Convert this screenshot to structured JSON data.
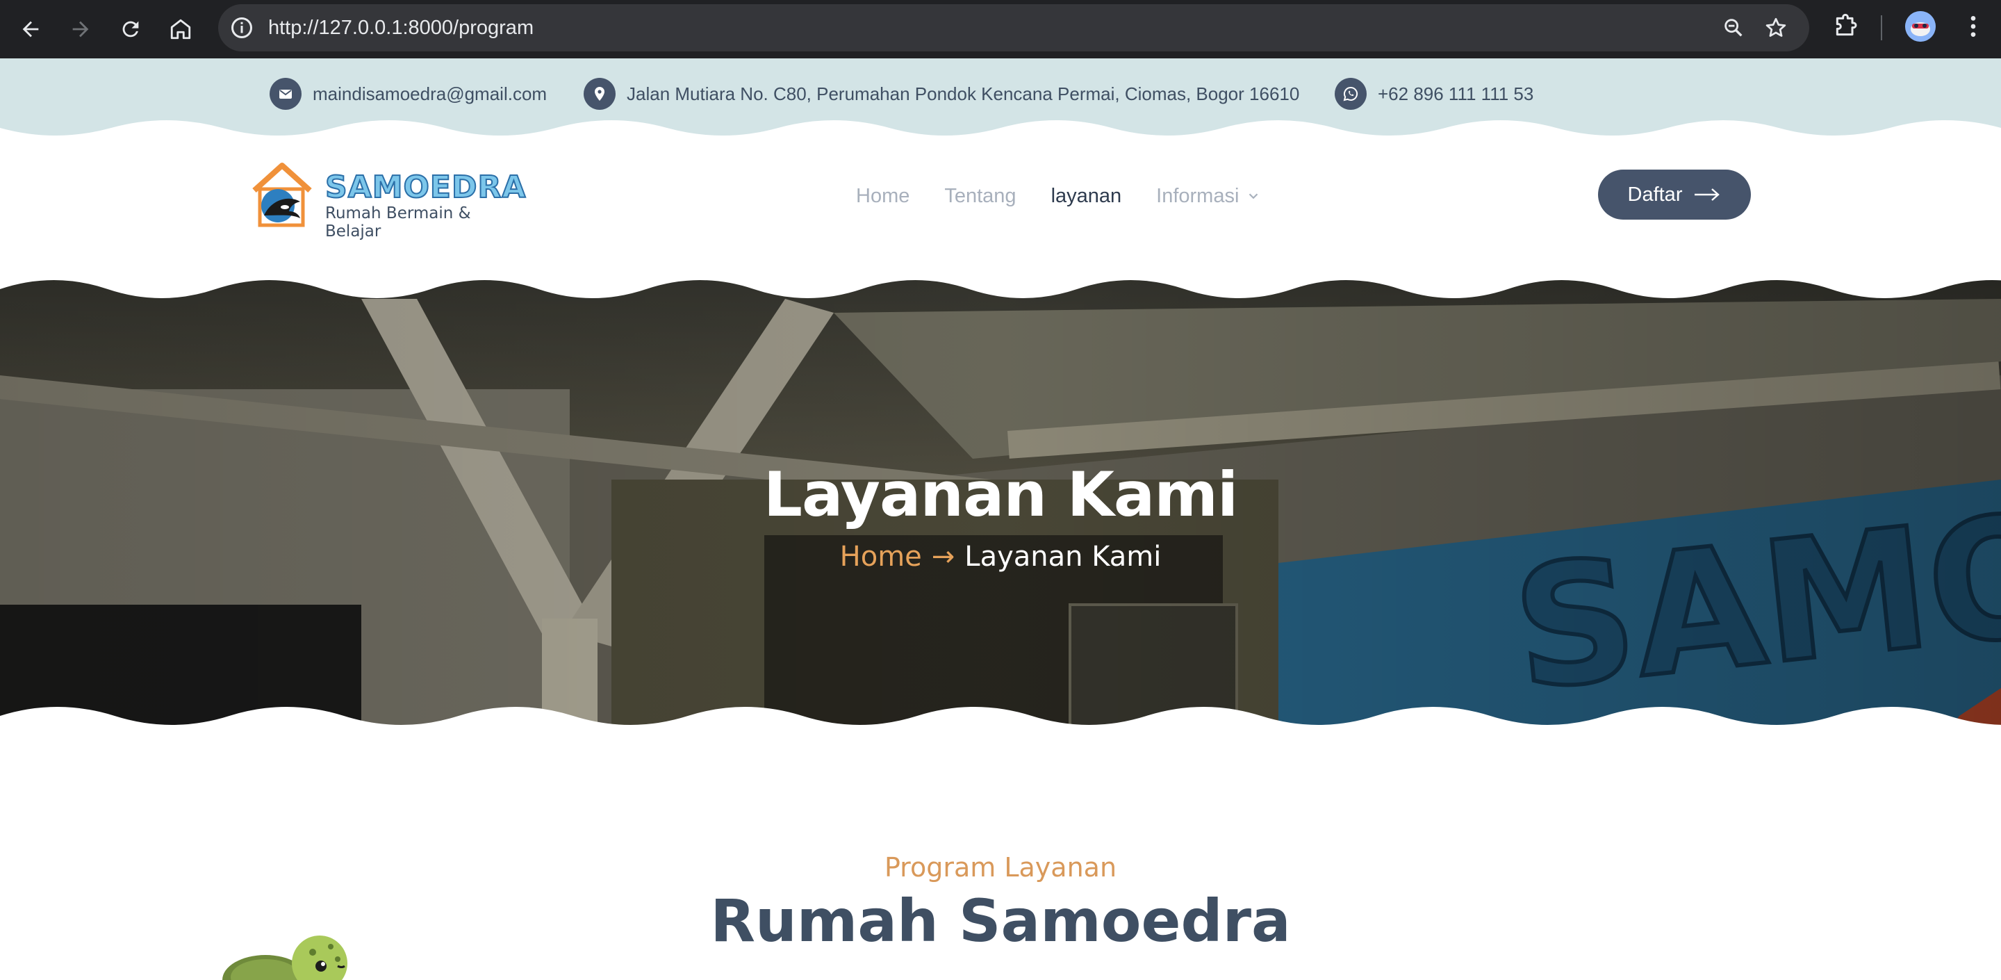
{
  "browser": {
    "url": "http://127.0.0.1:8000/program"
  },
  "topbar": {
    "email": "maindisamoedra@gmail.com",
    "address": "Jalan Mutiara No. C80, Perumahan Pondok Kencana Permai, Ciomas, Bogor 16610",
    "phone": "+62 896 111 111 53"
  },
  "logo": {
    "brand": "SAMOEDRA",
    "tagline": "Rumah Bermain & Belajar"
  },
  "nav": {
    "items": [
      {
        "label": "Home",
        "active": false
      },
      {
        "label": "Tentang",
        "active": false
      },
      {
        "label": "layanan",
        "active": true
      }
    ],
    "dropdown_label": "Informasi",
    "cta_label": "Daftar"
  },
  "hero": {
    "title": "Layanan Kami",
    "breadcrumb_home": "Home",
    "breadcrumb_arrow": "→",
    "breadcrumb_current": "Layanan Kami"
  },
  "section": {
    "subtitle": "Program Layanan",
    "title": "Rumah Samoedra"
  },
  "colors": {
    "topbar_bg": "#d3e4e6",
    "primary": "#46546b",
    "accent": "#e6a25a",
    "nav_muted": "#a8b0bc"
  },
  "icons": {
    "email": "mail-icon",
    "address": "map-pin-icon",
    "phone": "whatsapp-icon"
  }
}
